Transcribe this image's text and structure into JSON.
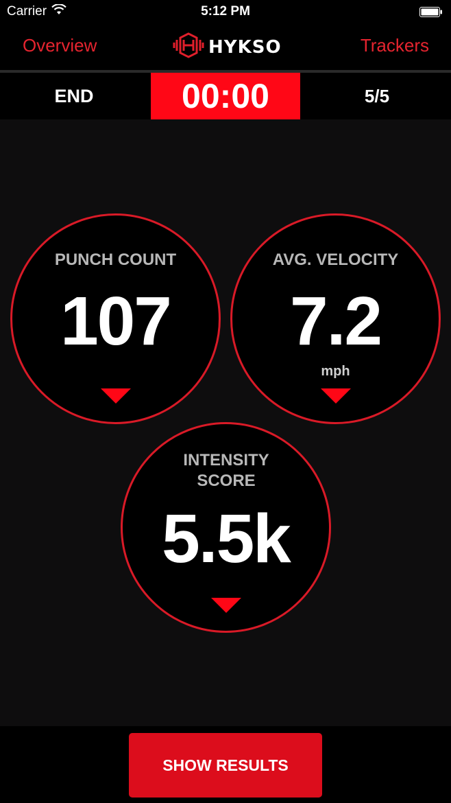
{
  "status_bar": {
    "carrier": "Carrier",
    "time": "5:12 PM",
    "wifi_icon": "wifi-icon",
    "battery_icon": "battery-icon"
  },
  "nav": {
    "left_label": "Overview",
    "logo_text": "HYKSO",
    "right_label": "Trackers"
  },
  "timer_bar": {
    "end_label": "END",
    "timer": "00:00",
    "round": "5/5"
  },
  "metrics": {
    "punch_count": {
      "label": "PUNCH COUNT",
      "value": "107"
    },
    "avg_velocity": {
      "label": "AVG. VELOCITY",
      "value": "7.2",
      "unit": "mph"
    },
    "intensity": {
      "label": "INTENSITY SCORE",
      "value": "5.5k"
    }
  },
  "footer": {
    "show_results_label": "SHOW RESULTS"
  },
  "colors": {
    "accent": "#ff0716",
    "ring": "#d91a27",
    "nav_link": "#e5242f",
    "background": "#0e0d0e"
  }
}
